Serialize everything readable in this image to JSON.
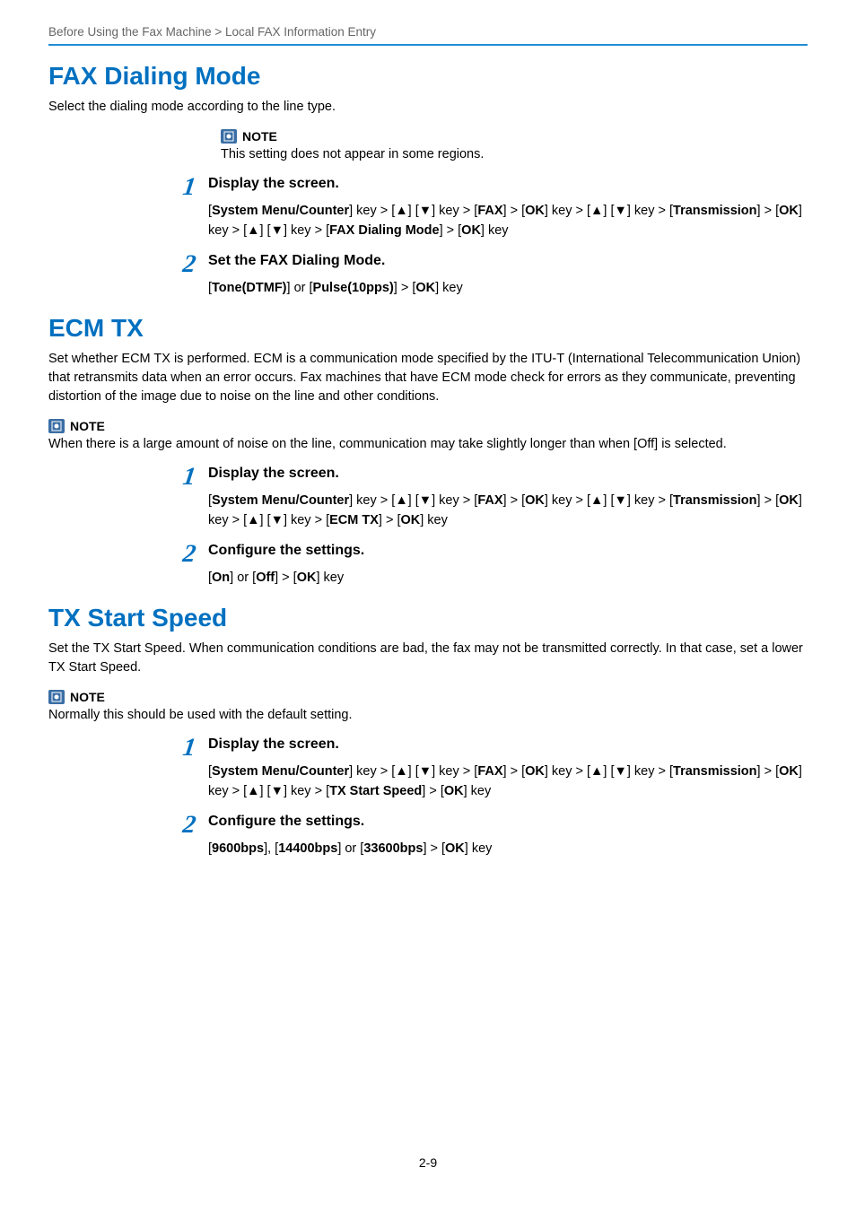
{
  "breadcrumb": "Before Using the Fax Machine > Local FAX Information Entry",
  "page_number": "2-9",
  "note_label": "NOTE",
  "sections": [
    {
      "title": "FAX Dialing Mode",
      "intro": "Select the dialing mode according to the line type.",
      "note_indented": true,
      "note": "This setting does not appear in some regions.",
      "steps": [
        {
          "num": "1",
          "title": "Display the screen.",
          "body_html": "[<b>System Menu/Counter</b>] key > [<b>▲</b>] [<b>▼</b>] key > [<b>FAX</b>] > [<b>OK</b>] key > [<b>▲</b>] [<b>▼</b>] key > [<b>Transmission</b>] > [<b>OK</b>] key > [<b>▲</b>] [<b>▼</b>] key > [<b>FAX Dialing Mode</b>] > [<b>OK</b>] key"
        },
        {
          "num": "2",
          "title": "Set the FAX Dialing Mode.",
          "body_html": "[<b>Tone(DTMF)</b>] or [<b>Pulse(10pps)</b>] > [<b>OK</b>] key"
        }
      ]
    },
    {
      "title": "ECM TX",
      "intro": "Set whether ECM TX is performed. ECM is a communication mode specified by the ITU-T (International Telecommunication Union) that retransmits data when an error occurs. Fax machines that have ECM mode check for errors as they communicate, preventing distortion of the image due to noise on the line and other conditions.",
      "note_indented": false,
      "note": "When there is a large amount of noise on the line, communication may take slightly longer than when [Off] is selected.",
      "steps": [
        {
          "num": "1",
          "title": "Display the screen.",
          "body_html": "[<b>System Menu/Counter</b>] key > [<b>▲</b>] [<b>▼</b>] key > [<b>FAX</b>] > [<b>OK</b>] key > [<b>▲</b>] [<b>▼</b>] key > [<b>Transmission</b>] > [<b>OK</b>] key > [<b>▲</b>] [<b>▼</b>] key > [<b>ECM TX</b>] > [<b>OK</b>] key"
        },
        {
          "num": "2",
          "title": "Configure the settings.",
          "body_html": "[<b>On</b>] or [<b>Off</b>] > [<b>OK</b>] key"
        }
      ]
    },
    {
      "title": "TX Start Speed",
      "intro": "Set the TX Start Speed. When communication conditions are bad, the fax may not be transmitted correctly. In that case, set a lower TX Start Speed.",
      "note_indented": false,
      "note": "Normally this should be used with the default setting.",
      "steps": [
        {
          "num": "1",
          "title": "Display the screen.",
          "body_html": "[<b>System Menu/Counter</b>] key > [<b>▲</b>] [<b>▼</b>] key > [<b>FAX</b>] > [<b>OK</b>] key > [<b>▲</b>] [<b>▼</b>] key > [<b>Transmission</b>] > [<b>OK</b>] key > [<b>▲</b>] [<b>▼</b>] key > [<b>TX Start Speed</b>] > [<b>OK</b>] key"
        },
        {
          "num": "2",
          "title": "Configure the settings.",
          "body_html": "[<b>9600bps</b>], [<b>14400bps</b>] or [<b>33600bps</b>] > [<b>OK</b>] key"
        }
      ]
    }
  ]
}
